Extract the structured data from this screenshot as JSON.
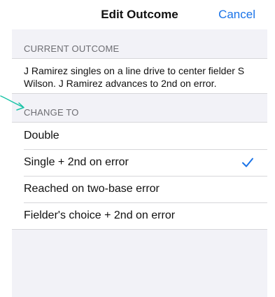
{
  "nav": {
    "title": "Edit Outcome",
    "cancel_label": "Cancel"
  },
  "current_outcome": {
    "header": "CURRENT OUTCOME",
    "text": "J Ramirez singles on a line drive to center fielder S Wilson. J Ramirez advances to 2nd on error."
  },
  "change_to": {
    "header": "CHANGE TO",
    "options": [
      {
        "label": "Double",
        "selected": false
      },
      {
        "label": "Single + 2nd on error",
        "selected": true
      },
      {
        "label": "Reached on two-base error",
        "selected": false
      },
      {
        "label": "Fielder's choice + 2nd on error",
        "selected": false
      }
    ]
  },
  "colors": {
    "accent": "#1a73e8",
    "annotation_arrow": "#19c3a6",
    "grouped_background": "#f2f2f7"
  },
  "icons": {
    "selected": "checkmark-icon",
    "annotation": "annotation-arrow-icon"
  }
}
